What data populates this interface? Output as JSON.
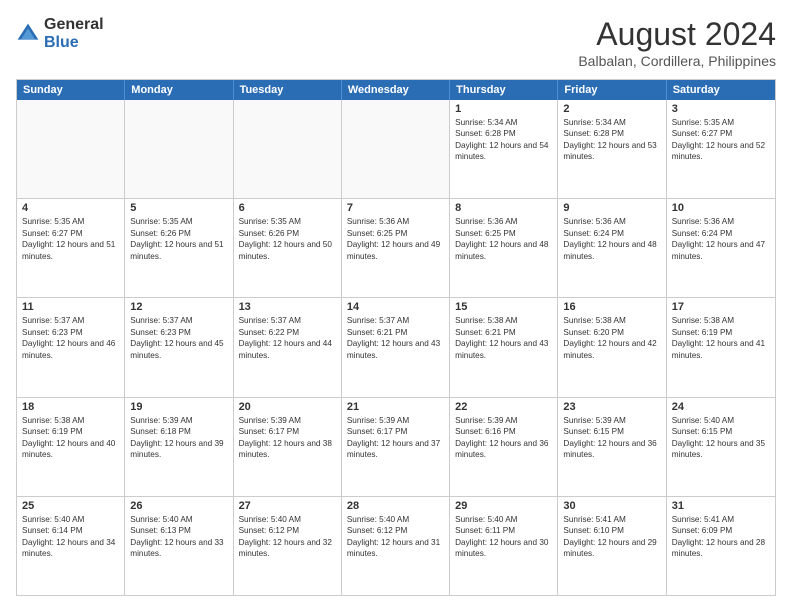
{
  "logo": {
    "general": "General",
    "blue": "Blue"
  },
  "title": "August 2024",
  "subtitle": "Balbalan, Cordillera, Philippines",
  "weekdays": [
    "Sunday",
    "Monday",
    "Tuesday",
    "Wednesday",
    "Thursday",
    "Friday",
    "Saturday"
  ],
  "weeks": [
    [
      {
        "day": "",
        "sunrise": "",
        "sunset": "",
        "daylight": ""
      },
      {
        "day": "",
        "sunrise": "",
        "sunset": "",
        "daylight": ""
      },
      {
        "day": "",
        "sunrise": "",
        "sunset": "",
        "daylight": ""
      },
      {
        "day": "",
        "sunrise": "",
        "sunset": "",
        "daylight": ""
      },
      {
        "day": "1",
        "sunrise": "Sunrise: 5:34 AM",
        "sunset": "Sunset: 6:28 PM",
        "daylight": "Daylight: 12 hours and 54 minutes."
      },
      {
        "day": "2",
        "sunrise": "Sunrise: 5:34 AM",
        "sunset": "Sunset: 6:28 PM",
        "daylight": "Daylight: 12 hours and 53 minutes."
      },
      {
        "day": "3",
        "sunrise": "Sunrise: 5:35 AM",
        "sunset": "Sunset: 6:27 PM",
        "daylight": "Daylight: 12 hours and 52 minutes."
      }
    ],
    [
      {
        "day": "4",
        "sunrise": "Sunrise: 5:35 AM",
        "sunset": "Sunset: 6:27 PM",
        "daylight": "Daylight: 12 hours and 51 minutes."
      },
      {
        "day": "5",
        "sunrise": "Sunrise: 5:35 AM",
        "sunset": "Sunset: 6:26 PM",
        "daylight": "Daylight: 12 hours and 51 minutes."
      },
      {
        "day": "6",
        "sunrise": "Sunrise: 5:35 AM",
        "sunset": "Sunset: 6:26 PM",
        "daylight": "Daylight: 12 hours and 50 minutes."
      },
      {
        "day": "7",
        "sunrise": "Sunrise: 5:36 AM",
        "sunset": "Sunset: 6:25 PM",
        "daylight": "Daylight: 12 hours and 49 minutes."
      },
      {
        "day": "8",
        "sunrise": "Sunrise: 5:36 AM",
        "sunset": "Sunset: 6:25 PM",
        "daylight": "Daylight: 12 hours and 48 minutes."
      },
      {
        "day": "9",
        "sunrise": "Sunrise: 5:36 AM",
        "sunset": "Sunset: 6:24 PM",
        "daylight": "Daylight: 12 hours and 48 minutes."
      },
      {
        "day": "10",
        "sunrise": "Sunrise: 5:36 AM",
        "sunset": "Sunset: 6:24 PM",
        "daylight": "Daylight: 12 hours and 47 minutes."
      }
    ],
    [
      {
        "day": "11",
        "sunrise": "Sunrise: 5:37 AM",
        "sunset": "Sunset: 6:23 PM",
        "daylight": "Daylight: 12 hours and 46 minutes."
      },
      {
        "day": "12",
        "sunrise": "Sunrise: 5:37 AM",
        "sunset": "Sunset: 6:23 PM",
        "daylight": "Daylight: 12 hours and 45 minutes."
      },
      {
        "day": "13",
        "sunrise": "Sunrise: 5:37 AM",
        "sunset": "Sunset: 6:22 PM",
        "daylight": "Daylight: 12 hours and 44 minutes."
      },
      {
        "day": "14",
        "sunrise": "Sunrise: 5:37 AM",
        "sunset": "Sunset: 6:21 PM",
        "daylight": "Daylight: 12 hours and 43 minutes."
      },
      {
        "day": "15",
        "sunrise": "Sunrise: 5:38 AM",
        "sunset": "Sunset: 6:21 PM",
        "daylight": "Daylight: 12 hours and 43 minutes."
      },
      {
        "day": "16",
        "sunrise": "Sunrise: 5:38 AM",
        "sunset": "Sunset: 6:20 PM",
        "daylight": "Daylight: 12 hours and 42 minutes."
      },
      {
        "day": "17",
        "sunrise": "Sunrise: 5:38 AM",
        "sunset": "Sunset: 6:19 PM",
        "daylight": "Daylight: 12 hours and 41 minutes."
      }
    ],
    [
      {
        "day": "18",
        "sunrise": "Sunrise: 5:38 AM",
        "sunset": "Sunset: 6:19 PM",
        "daylight": "Daylight: 12 hours and 40 minutes."
      },
      {
        "day": "19",
        "sunrise": "Sunrise: 5:39 AM",
        "sunset": "Sunset: 6:18 PM",
        "daylight": "Daylight: 12 hours and 39 minutes."
      },
      {
        "day": "20",
        "sunrise": "Sunrise: 5:39 AM",
        "sunset": "Sunset: 6:17 PM",
        "daylight": "Daylight: 12 hours and 38 minutes."
      },
      {
        "day": "21",
        "sunrise": "Sunrise: 5:39 AM",
        "sunset": "Sunset: 6:17 PM",
        "daylight": "Daylight: 12 hours and 37 minutes."
      },
      {
        "day": "22",
        "sunrise": "Sunrise: 5:39 AM",
        "sunset": "Sunset: 6:16 PM",
        "daylight": "Daylight: 12 hours and 36 minutes."
      },
      {
        "day": "23",
        "sunrise": "Sunrise: 5:39 AM",
        "sunset": "Sunset: 6:15 PM",
        "daylight": "Daylight: 12 hours and 36 minutes."
      },
      {
        "day": "24",
        "sunrise": "Sunrise: 5:40 AM",
        "sunset": "Sunset: 6:15 PM",
        "daylight": "Daylight: 12 hours and 35 minutes."
      }
    ],
    [
      {
        "day": "25",
        "sunrise": "Sunrise: 5:40 AM",
        "sunset": "Sunset: 6:14 PM",
        "daylight": "Daylight: 12 hours and 34 minutes."
      },
      {
        "day": "26",
        "sunrise": "Sunrise: 5:40 AM",
        "sunset": "Sunset: 6:13 PM",
        "daylight": "Daylight: 12 hours and 33 minutes."
      },
      {
        "day": "27",
        "sunrise": "Sunrise: 5:40 AM",
        "sunset": "Sunset: 6:12 PM",
        "daylight": "Daylight: 12 hours and 32 minutes."
      },
      {
        "day": "28",
        "sunrise": "Sunrise: 5:40 AM",
        "sunset": "Sunset: 6:12 PM",
        "daylight": "Daylight: 12 hours and 31 minutes."
      },
      {
        "day": "29",
        "sunrise": "Sunrise: 5:40 AM",
        "sunset": "Sunset: 6:11 PM",
        "daylight": "Daylight: 12 hours and 30 minutes."
      },
      {
        "day": "30",
        "sunrise": "Sunrise: 5:41 AM",
        "sunset": "Sunset: 6:10 PM",
        "daylight": "Daylight: 12 hours and 29 minutes."
      },
      {
        "day": "31",
        "sunrise": "Sunrise: 5:41 AM",
        "sunset": "Sunset: 6:09 PM",
        "daylight": "Daylight: 12 hours and 28 minutes."
      }
    ]
  ]
}
